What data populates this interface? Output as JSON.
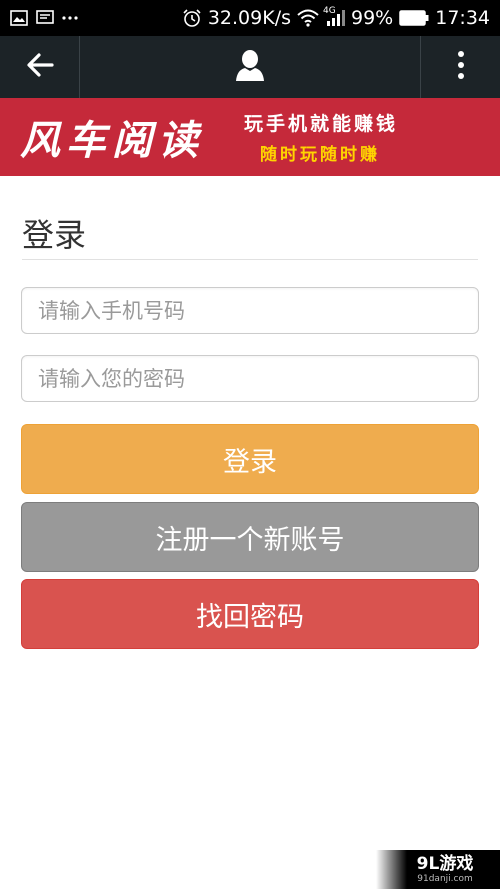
{
  "status_bar": {
    "net_speed": "32.09K/s",
    "battery": "99%",
    "time": "17:34",
    "network_type": "4G",
    "icons": [
      "image-icon",
      "message-icon",
      "more-dots-icon",
      "alarm-icon",
      "wifi-icon",
      "signal-icon",
      "battery-icon"
    ]
  },
  "app_bar": {
    "icons": [
      "back-arrow-icon",
      "user-icon",
      "more-vertical-icon"
    ]
  },
  "banner": {
    "brand": "风车阅读",
    "slogan_line1": "玩手机就能赚钱",
    "slogan_line2": "随时玩随时赚",
    "colors": {
      "background": "#c5293a",
      "slogan_line2": "#ffd400"
    }
  },
  "form": {
    "title": "登录",
    "phone_placeholder": "请输入手机号码",
    "password_placeholder": "请输入您的密码",
    "login_button": "登录",
    "register_button": "注册一个新账号",
    "recover_button": "找回密码",
    "colors": {
      "login": "#efac4e",
      "register": "#999999",
      "recover": "#d9534f"
    }
  },
  "watermark": {
    "brand": "9L游戏",
    "url": "91danji.com"
  }
}
